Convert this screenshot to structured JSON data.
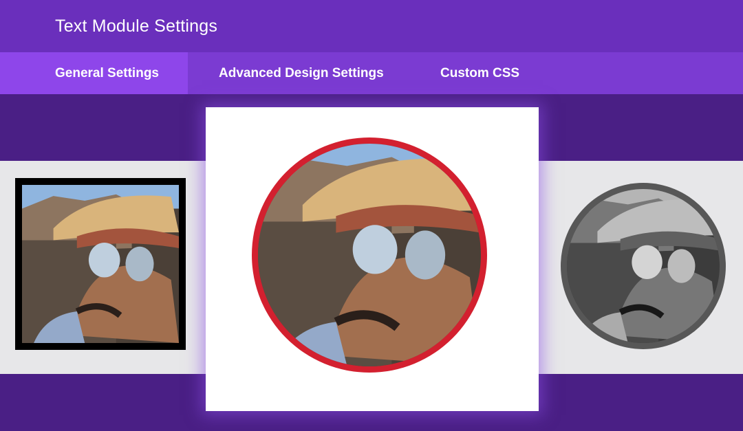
{
  "header": {
    "title": "Text Module Settings"
  },
  "tabs": [
    {
      "label": "General Settings",
      "active": true
    },
    {
      "label": "Advanced Design Settings",
      "active": false
    },
    {
      "label": "Custom CSS",
      "active": false
    }
  ],
  "colors": {
    "title_bar": "#6a2fbc",
    "tab_bar": "#7b3bd2",
    "active_tab": "#8e46ea",
    "page_background": "#4a1f85",
    "gray_band": "#e7e7e9",
    "square_border": "#000000",
    "red_ring": "#d3202f",
    "gray_ring": "#575757"
  },
  "avatars": [
    {
      "style": "square",
      "border": "black"
    },
    {
      "style": "circle",
      "border": "red"
    },
    {
      "style": "circle",
      "border": "gray",
      "filter": "grayscale"
    }
  ]
}
